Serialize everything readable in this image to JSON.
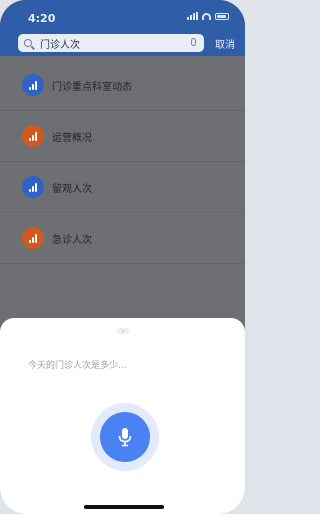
{
  "status_bar": {
    "time": "4:20"
  },
  "search": {
    "query": "门诊人次",
    "cancel_label": "取消"
  },
  "results": [
    {
      "label": "门诊重点科室动态",
      "icon": "bar-chart-icon",
      "color": "#2e62c4"
    },
    {
      "label": "运营概况",
      "icon": "bar-chart-icon",
      "color": "#d2581e"
    },
    {
      "label": "留观人次",
      "icon": "bar-chart-icon",
      "color": "#2e62c4"
    },
    {
      "label": "急诊人次",
      "icon": "bar-chart-icon",
      "color": "#d2581e"
    }
  ],
  "voice_sheet": {
    "transcript": "今天的门诊人次是多少...",
    "accent": "#4a82f3"
  }
}
